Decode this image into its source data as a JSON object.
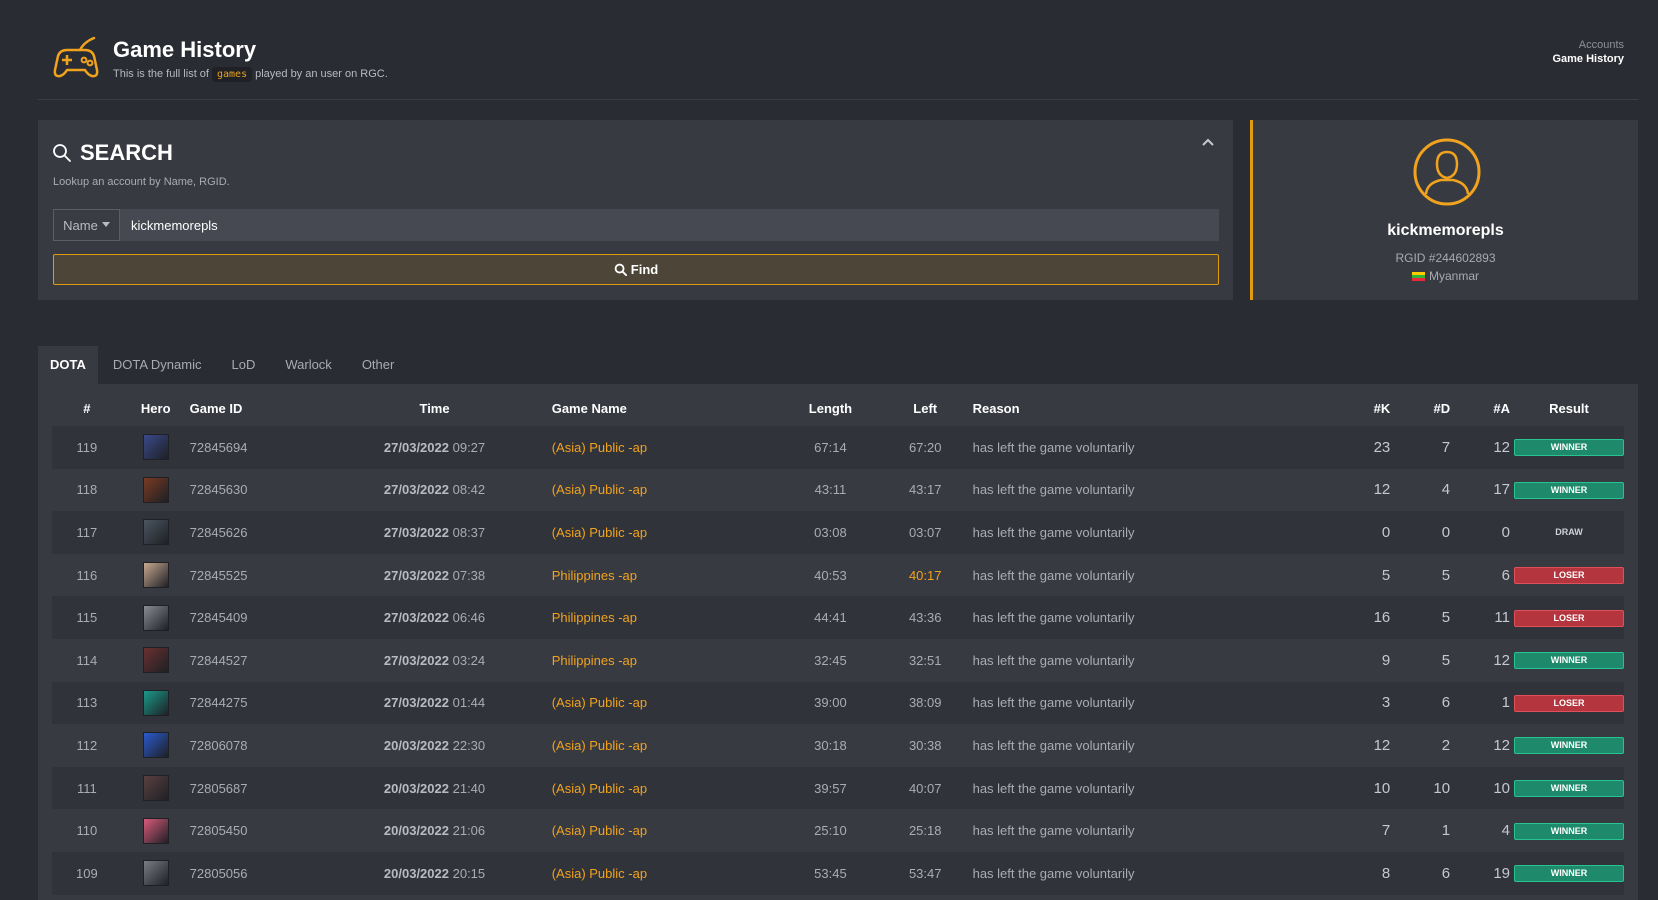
{
  "header": {
    "title": "Game History",
    "subtitle_before": "This is the full list of",
    "subtitle_code": "games",
    "subtitle_after": "played by an user on RGC.",
    "breadcrumb": [
      "Accounts",
      "Game History"
    ]
  },
  "search": {
    "title": "SEARCH",
    "help": "Lookup an account by Name, RGID.",
    "field_type": "Name",
    "value": "kickmemorepls",
    "find_label": "Find"
  },
  "profile": {
    "name": "kickmemorepls",
    "rgid": "RGID #244602893",
    "country": "Myanmar"
  },
  "tabs": [
    "DOTA",
    "DOTA Dynamic",
    "LoD",
    "Warlock",
    "Other"
  ],
  "table": {
    "columns": [
      "#",
      "Hero",
      "Game ID",
      "Time",
      "Game Name",
      "Length",
      "Left",
      "Reason",
      "#K",
      "#D",
      "#A",
      "Result"
    ],
    "rows": [
      {
        "num": "119",
        "hero": "hero-1",
        "id": "72845694",
        "date": "27/03/2022",
        "time": "09:27",
        "game": "(Asia) Public -ap",
        "length": "67:14",
        "left": "67:20",
        "reason": "has left the game voluntarily",
        "k": "23",
        "d": "7",
        "a": "12",
        "result": "WINNER"
      },
      {
        "num": "118",
        "hero": "hero-2",
        "id": "72845630",
        "date": "27/03/2022",
        "time": "08:42",
        "game": "(Asia) Public -ap",
        "length": "43:11",
        "left": "43:17",
        "reason": "has left the game voluntarily",
        "k": "12",
        "d": "4",
        "a": "17",
        "result": "WINNER"
      },
      {
        "num": "117",
        "hero": "hero-3",
        "id": "72845626",
        "date": "27/03/2022",
        "time": "08:37",
        "game": "(Asia) Public -ap",
        "length": "03:08",
        "left": "03:07",
        "reason": "has left the game voluntarily",
        "k": "0",
        "d": "0",
        "a": "0",
        "result": "DRAW"
      },
      {
        "num": "116",
        "hero": "hero-4",
        "id": "72845525",
        "date": "27/03/2022",
        "time": "07:38",
        "game": "Philippines -ap",
        "length": "40:53",
        "left": "40:17",
        "reason": "has left the game voluntarily",
        "k": "5",
        "d": "5",
        "a": "6",
        "result": "LOSER"
      },
      {
        "num": "115",
        "hero": "hero-5",
        "id": "72845409",
        "date": "27/03/2022",
        "time": "06:46",
        "game": "Philippines -ap",
        "length": "44:41",
        "left": "43:36",
        "reason": "has left the game voluntarily",
        "k": "16",
        "d": "5",
        "a": "11",
        "result": "LOSER"
      },
      {
        "num": "114",
        "hero": "hero-6",
        "id": "72844527",
        "date": "27/03/2022",
        "time": "03:24",
        "game": "Philippines -ap",
        "length": "32:45",
        "left": "32:51",
        "reason": "has left the game voluntarily",
        "k": "9",
        "d": "5",
        "a": "12",
        "result": "WINNER"
      },
      {
        "num": "113",
        "hero": "hero-7",
        "id": "72844275",
        "date": "27/03/2022",
        "time": "01:44",
        "game": "(Asia) Public -ap",
        "length": "39:00",
        "left": "38:09",
        "reason": "has left the game voluntarily",
        "k": "3",
        "d": "6",
        "a": "1",
        "result": "LOSER"
      },
      {
        "num": "112",
        "hero": "hero-8",
        "id": "72806078",
        "date": "20/03/2022",
        "time": "22:30",
        "game": "(Asia) Public -ap",
        "length": "30:18",
        "left": "30:38",
        "reason": "has left the game voluntarily",
        "k": "12",
        "d": "2",
        "a": "12",
        "result": "WINNER"
      },
      {
        "num": "111",
        "hero": "hero-9",
        "id": "72805687",
        "date": "20/03/2022",
        "time": "21:40",
        "game": "(Asia) Public -ap",
        "length": "39:57",
        "left": "40:07",
        "reason": "has left the game voluntarily",
        "k": "10",
        "d": "10",
        "a": "10",
        "result": "WINNER"
      },
      {
        "num": "110",
        "hero": "hero-10",
        "id": "72805450",
        "date": "20/03/2022",
        "time": "21:06",
        "game": "(Asia) Public -ap",
        "length": "25:10",
        "left": "25:18",
        "reason": "has left the game voluntarily",
        "k": "7",
        "d": "1",
        "a": "4",
        "result": "WINNER"
      },
      {
        "num": "109",
        "hero": "hero-11",
        "id": "72805056",
        "date": "20/03/2022",
        "time": "20:15",
        "game": "(Asia) Public -ap",
        "length": "53:45",
        "left": "53:47",
        "reason": "has left the game voluntarily",
        "k": "8",
        "d": "6",
        "a": "19",
        "result": "WINNER"
      }
    ]
  },
  "colors": {
    "accent": "#e29a10",
    "background": "#2a2c33",
    "panel": "#383a42",
    "winner": "#1f8a6b",
    "loser": "#b4353d",
    "hero_icons": [
      "#3a4a8a",
      "#7a3a22",
      "#4a5560",
      "#c8a890",
      "#8a8c96",
      "#6a3030",
      "#1a9a8a",
      "#2a5ad0",
      "#5a4040",
      "#d85a7a",
      "#7a7c86"
    ]
  },
  "icons": {
    "logo": "gamepad-icon",
    "search": "search-icon",
    "collapse": "chevron-up-icon",
    "avatar": "user-icon",
    "flag": "myanmar-flag-icon"
  }
}
